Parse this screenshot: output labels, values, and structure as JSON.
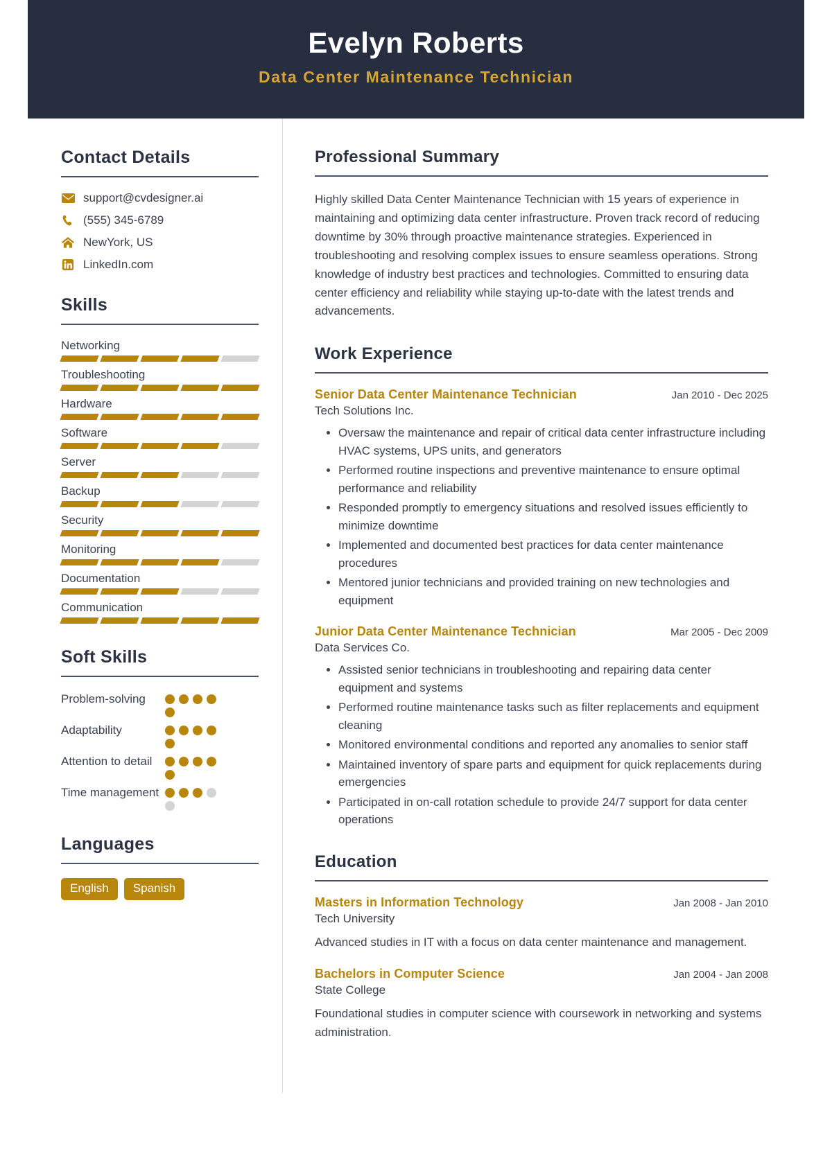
{
  "header": {
    "name": "Evelyn Roberts",
    "title": "Data Center Maintenance Technician",
    "bg_color": "#262e40",
    "accent_color": "#d8a531"
  },
  "theme": {
    "gold": "#b8860b",
    "navy": "#2b3242",
    "text": "#3c4250",
    "muted_bar": "#d4d4d4"
  },
  "sidebar": {
    "contact": {
      "heading": "Contact Details",
      "items": [
        {
          "icon": "envelope-icon",
          "value": "support@cvdesigner.ai"
        },
        {
          "icon": "phone-icon",
          "value": "(555) 345-6789"
        },
        {
          "icon": "home-icon",
          "value": "NewYork, US"
        },
        {
          "icon": "linkedin-icon",
          "value": "LinkedIn.com"
        }
      ]
    },
    "skills": {
      "heading": "Skills",
      "max": 5,
      "items": [
        {
          "name": "Networking",
          "level": 4
        },
        {
          "name": "Troubleshooting",
          "level": 5
        },
        {
          "name": "Hardware",
          "level": 5
        },
        {
          "name": "Software",
          "level": 4
        },
        {
          "name": "Server",
          "level": 3
        },
        {
          "name": "Backup",
          "level": 3
        },
        {
          "name": "Security",
          "level": 5
        },
        {
          "name": "Monitoring",
          "level": 4
        },
        {
          "name": "Documentation",
          "level": 3
        },
        {
          "name": "Communication",
          "level": 5
        }
      ]
    },
    "soft_skills": {
      "heading": "Soft Skills",
      "max": 5,
      "items": [
        {
          "name": "Problem-solving",
          "level": 5
        },
        {
          "name": "Adaptability",
          "level": 5
        },
        {
          "name": "Attention to detail",
          "level": 5
        },
        {
          "name": "Time management",
          "level": 3
        }
      ]
    },
    "languages": {
      "heading": "Languages",
      "items": [
        "English",
        "Spanish"
      ]
    }
  },
  "main": {
    "summary": {
      "heading": "Professional Summary",
      "text": "Highly skilled Data Center Maintenance Technician with 15 years of experience in maintaining and optimizing data center infrastructure. Proven track record of reducing downtime by 30% through proactive maintenance strategies. Experienced in troubleshooting and resolving complex issues to ensure seamless operations. Strong knowledge of industry best practices and technologies. Committed to ensuring data center efficiency and reliability while staying up-to-date with the latest trends and advancements."
    },
    "work": {
      "heading": "Work Experience",
      "entries": [
        {
          "title": "Senior Data Center Maintenance Technician",
          "date": "Jan 2010 - Dec 2025",
          "org": "Tech Solutions Inc.",
          "bullets": [
            "Oversaw the maintenance and repair of critical data center infrastructure including HVAC systems, UPS units, and generators",
            "Performed routine inspections and preventive maintenance to ensure optimal performance and reliability",
            "Responded promptly to emergency situations and resolved issues efficiently to minimize downtime",
            "Implemented and documented best practices for data center maintenance procedures",
            "Mentored junior technicians and provided training on new technologies and equipment"
          ]
        },
        {
          "title": "Junior Data Center Maintenance Technician",
          "date": "Mar 2005 - Dec 2009",
          "org": "Data Services Co.",
          "bullets": [
            "Assisted senior technicians in troubleshooting and repairing data center equipment and systems",
            "Performed routine maintenance tasks such as filter replacements and equipment cleaning",
            "Monitored environmental conditions and reported any anomalies to senior staff",
            "Maintained inventory of spare parts and equipment for quick replacements during emergencies",
            "Participated in on-call rotation schedule to provide 24/7 support for data center operations"
          ]
        }
      ]
    },
    "education": {
      "heading": "Education",
      "entries": [
        {
          "title": "Masters in Information Technology",
          "date": "Jan 2008 - Jan 2010",
          "org": "Tech University",
          "desc": "Advanced studies in IT with a focus on data center maintenance and management."
        },
        {
          "title": "Bachelors in Computer Science",
          "date": "Jan 2004 - Jan 2008",
          "org": "State College",
          "desc": "Foundational studies in computer science with coursework in networking and systems administration."
        }
      ]
    }
  }
}
